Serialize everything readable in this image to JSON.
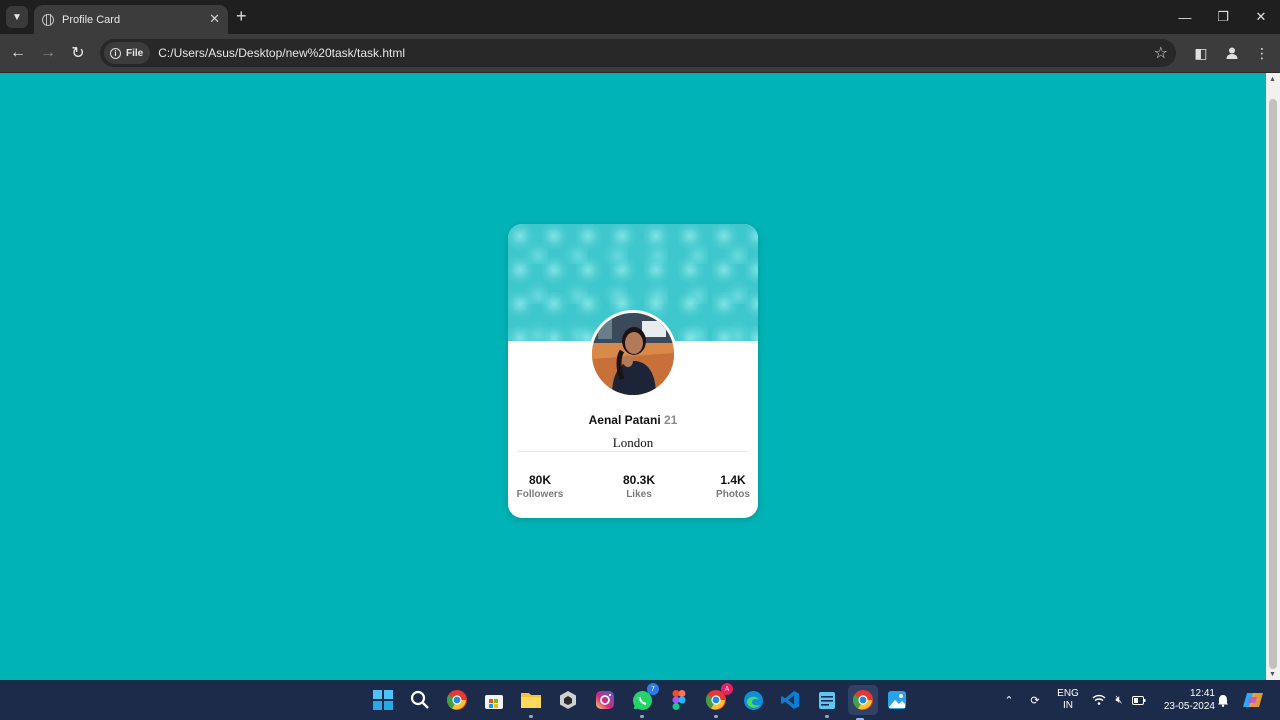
{
  "browser": {
    "tab_title": "Profile Card",
    "site_chip": "File",
    "url": "C:/Users/Asus/Desktop/new%20task/task.html"
  },
  "profile": {
    "name": "Aenal Patani",
    "age": "21",
    "city": "London",
    "stats": [
      {
        "value": "80K",
        "label": "Followers"
      },
      {
        "value": "80.3K",
        "label": "Likes"
      },
      {
        "value": "1.4K",
        "label": "Photos"
      }
    ]
  },
  "colors": {
    "page_background": "#00b3b6",
    "card_background": "#ffffff",
    "cover": "#3ec7cc"
  },
  "taskbar": {
    "icons": [
      "windows-start-icon",
      "search-icon",
      "chrome-icon",
      "microsoft-store-icon",
      "file-explorer-icon",
      "unity-icon",
      "instagram-icon",
      "whatsapp-icon",
      "figma-icon",
      "chrome-profile-icon",
      "edge-icon",
      "vscode-icon",
      "notepad-icon",
      "chrome-active-icon",
      "photos-icon"
    ],
    "whatsapp_badge": "7",
    "chrome_profile_badge": "A",
    "language_top": "ENG",
    "language_bottom": "IN",
    "time": "12:41",
    "date": "23-05-2024"
  }
}
